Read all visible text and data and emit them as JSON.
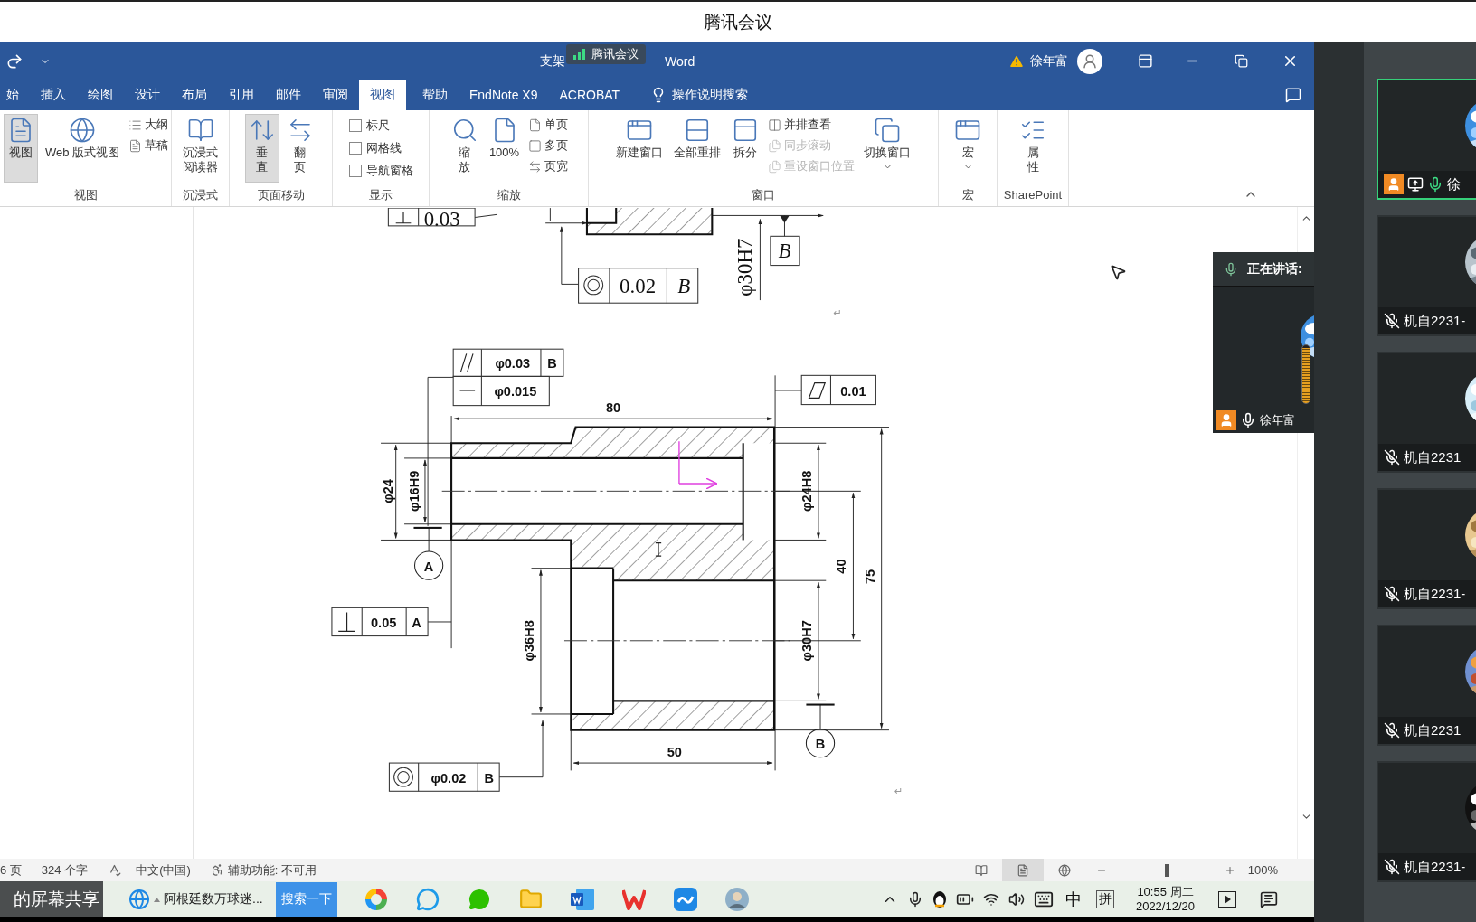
{
  "meeting_title": "腾讯会议",
  "word": {
    "title_parts": [
      "支架",
      "Word"
    ],
    "share_badge": "腾讯会议",
    "user": "徐年富",
    "tabs": [
      {
        "label": "始",
        "selected": false
      },
      {
        "label": "插入",
        "selected": false
      },
      {
        "label": "绘图",
        "selected": false
      },
      {
        "label": "设计",
        "selected": false
      },
      {
        "label": "布局",
        "selected": false
      },
      {
        "label": "引用",
        "selected": false
      },
      {
        "label": "邮件",
        "selected": false
      },
      {
        "label": "审阅",
        "selected": false
      },
      {
        "label": "视图",
        "selected": true
      },
      {
        "label": "帮助",
        "selected": false
      },
      {
        "label": "EndNote X9",
        "selected": false
      },
      {
        "label": "ACROBAT",
        "selected": false
      }
    ],
    "tell_me": "操作说明搜索",
    "ribbon": [
      {
        "label": "视图",
        "controls": [
          {
            "kind": "large",
            "label": "视图",
            "selected": true
          },
          {
            "kind": "large",
            "label": "Web 版式视图",
            "selected": false
          },
          {
            "kind": "small",
            "label": "大纲",
            "disabled": false
          },
          {
            "kind": "small",
            "label": "草稿",
            "disabled": false
          }
        ]
      },
      {
        "label": "沉浸式",
        "controls": [
          {
            "kind": "large",
            "label": "沉浸式阅读器",
            "selected": false
          }
        ]
      },
      {
        "label": "页面移动",
        "controls": [
          {
            "kind": "large",
            "label": "垂直",
            "selected": true
          },
          {
            "kind": "large",
            "label": "翻页",
            "selected": false
          }
        ]
      },
      {
        "label": "显示",
        "controls": [
          {
            "kind": "check",
            "label": "标尺",
            "checked": false
          },
          {
            "kind": "check",
            "label": "网格线",
            "checked": false
          },
          {
            "kind": "check",
            "label": "导航窗格",
            "checked": false
          }
        ]
      },
      {
        "label": "缩放",
        "controls": [
          {
            "kind": "large",
            "label": "缩放",
            "selected": false
          },
          {
            "kind": "large",
            "label": "100%",
            "selected": false
          },
          {
            "kind": "small",
            "label": "单页",
            "disabled": false
          },
          {
            "kind": "small",
            "label": "多页",
            "disabled": false
          },
          {
            "kind": "small",
            "label": "页宽",
            "disabled": false
          }
        ]
      },
      {
        "label": "窗口",
        "controls": [
          {
            "kind": "large",
            "label": "新建窗口",
            "selected": false
          },
          {
            "kind": "large",
            "label": "全部重排",
            "selected": false
          },
          {
            "kind": "large",
            "label": "拆分",
            "selected": false
          },
          {
            "kind": "small",
            "label": "并排查看",
            "disabled": false
          },
          {
            "kind": "small",
            "label": "同步滚动",
            "disabled": true
          },
          {
            "kind": "small",
            "label": "重设窗口位置",
            "disabled": true
          },
          {
            "kind": "large",
            "label": "切换窗口",
            "selected": false,
            "menu": true
          }
        ]
      },
      {
        "label": "宏",
        "controls": [
          {
            "kind": "large",
            "label": "宏",
            "selected": false,
            "menu": true
          }
        ]
      },
      {
        "label": "SharePoint",
        "controls": [
          {
            "kind": "large",
            "label": "属性",
            "selected": false
          }
        ]
      }
    ]
  },
  "document": {
    "labels": [
      "0.03",
      "φ30H7",
      "B",
      "0.02",
      "B",
      "φ0.03",
      "B",
      "φ0.015",
      "0.01",
      "80",
      "φ24",
      "φ16H9",
      "φ24H8",
      "40",
      "75",
      "A",
      "0.05",
      "A",
      "φ36H8",
      "φ30H7",
      "B",
      "50",
      "φ0.02",
      "B"
    ],
    "paragraph_marks": [
      "↵",
      "↵"
    ]
  },
  "speaking_window": {
    "title": "正在讲话:",
    "speaker": "徐年富",
    "level": 0.95
  },
  "status_bar": {
    "page": "6 页",
    "words": "324 个字",
    "language": "中文(中国)",
    "accessibility": "辅助功能: 不可用",
    "views": [
      {
        "selected": false
      },
      {
        "selected": true
      },
      {
        "selected": false
      }
    ],
    "zoom": {
      "level": 0.51,
      "reading": "100%"
    }
  },
  "taskbar": {
    "share_label": "的屏幕共享",
    "browser_tab": "阿根廷数万球迷...",
    "search_button": "搜索一下",
    "ime_mode": "中",
    "ime": "拼",
    "time": "10:55 周二",
    "date": "2022/12/20"
  },
  "participants": [
    {
      "name": "徐",
      "selected": true,
      "host": true,
      "muted": false
    },
    {
      "name": "机自2231-",
      "selected": false,
      "host": false,
      "muted": true
    },
    {
      "name": "机自2231",
      "selected": false,
      "host": false,
      "muted": true
    },
    {
      "name": "机自2231-",
      "selected": false,
      "host": false,
      "muted": true
    },
    {
      "name": "机自2231",
      "selected": false,
      "host": false,
      "muted": true
    },
    {
      "name": "机自2231-",
      "selected": false,
      "host": false,
      "muted": true
    }
  ]
}
